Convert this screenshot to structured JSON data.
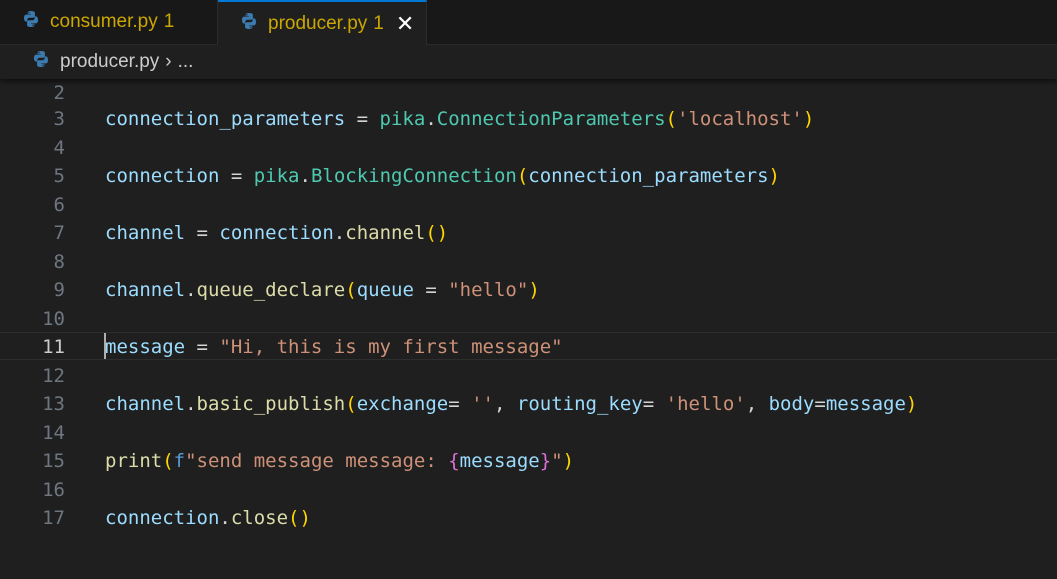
{
  "tabs": [
    {
      "name": "consumer.py",
      "problems": "1",
      "active": false
    },
    {
      "name": "producer.py",
      "problems": "1",
      "active": true
    }
  ],
  "close_glyph": "✕",
  "breadcrumb": {
    "file": "producer.py",
    "separator": "›",
    "more": "..."
  },
  "editor": {
    "current_line": 11,
    "lines": [
      {
        "num": "2"
      },
      {
        "num": "3"
      },
      {
        "num": "4"
      },
      {
        "num": "5"
      },
      {
        "num": "6"
      },
      {
        "num": "7"
      },
      {
        "num": "8"
      },
      {
        "num": "9"
      },
      {
        "num": "10"
      },
      {
        "num": "11"
      },
      {
        "num": "12"
      },
      {
        "num": "13"
      },
      {
        "num": "14"
      },
      {
        "num": "15"
      },
      {
        "num": "16"
      },
      {
        "num": "17"
      }
    ],
    "code": {
      "l3": [
        "connection_parameters",
        " = ",
        "pika",
        ".",
        "ConnectionParameters",
        "(",
        "'localhost'",
        ")"
      ],
      "l5": [
        "connection",
        " = ",
        "pika",
        ".",
        "BlockingConnection",
        "(",
        "connection_parameters",
        ")"
      ],
      "l7": [
        "channel",
        " = ",
        "connection",
        ".",
        "channel",
        "()"
      ],
      "l9": [
        "channel",
        ".",
        "queue_declare",
        "(",
        "queue",
        " = ",
        "\"hello\"",
        ")"
      ],
      "l11": [
        "message",
        " = ",
        "\"Hi, this is my first message\""
      ],
      "l13": [
        "channel",
        ".",
        "basic_publish",
        "(",
        "exchange",
        "= ",
        "''",
        ", ",
        "routing_key",
        "= ",
        "'hello'",
        ", ",
        "body",
        "=",
        "message",
        ")"
      ],
      "l15": [
        "print",
        "(",
        "f",
        "\"send message message: ",
        "{",
        "message",
        "}",
        "\"",
        ")"
      ],
      "l17": [
        "connection",
        ".",
        "close",
        "()"
      ]
    }
  },
  "colors": {
    "background": "#1f1f1f",
    "tab_warning": "#cca700",
    "variable": "#9cdcfe",
    "class": "#4ec9b0",
    "function": "#dcdcaa",
    "string": "#ce9178",
    "bracket": "#ffd700"
  },
  "icons": {
    "file": "python-icon",
    "close": "close-icon"
  }
}
